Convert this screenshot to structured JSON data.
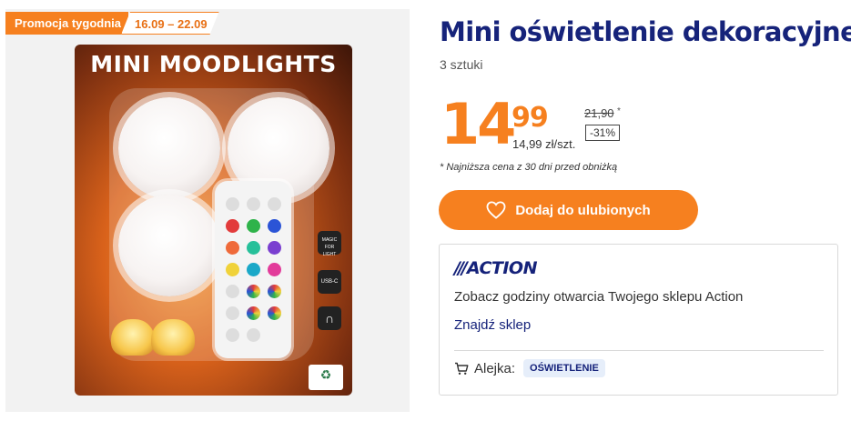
{
  "promo": {
    "label": "Promocja tygodnia",
    "dates": "16.09 – 22.09"
  },
  "product_image": {
    "package_title": "MINI MOODLIGHTS",
    "side_icons": [
      "MAGIC FOR LIGHT",
      "USB-C"
    ]
  },
  "product": {
    "title": "Mini oświetlenie dekoracyjne",
    "quantity": "3 sztuki"
  },
  "price": {
    "integer": "14",
    "decimal": "99",
    "unit_price": "14,99 zł/szt.",
    "old_price": "21,90",
    "old_price_marker": "*",
    "discount": "-31%",
    "footnote": "* Najniższa cena z 30 dni przed obniżką"
  },
  "favorites": {
    "label": "Dodaj do ulubionych",
    "icon": "heart-icon"
  },
  "store": {
    "logo": "ACTION",
    "logo_slashes": "///",
    "info_text": "Zobacz godziny otwarcia Twojego sklepu Action",
    "link_label": "Znajdź sklep",
    "aisle_label": "Alejka:",
    "aisle_value": "OŚWIETLENIE",
    "aisle_icon": "cart-icon"
  },
  "colors": {
    "accent": "#f6801f",
    "brand_navy": "#16237a"
  }
}
